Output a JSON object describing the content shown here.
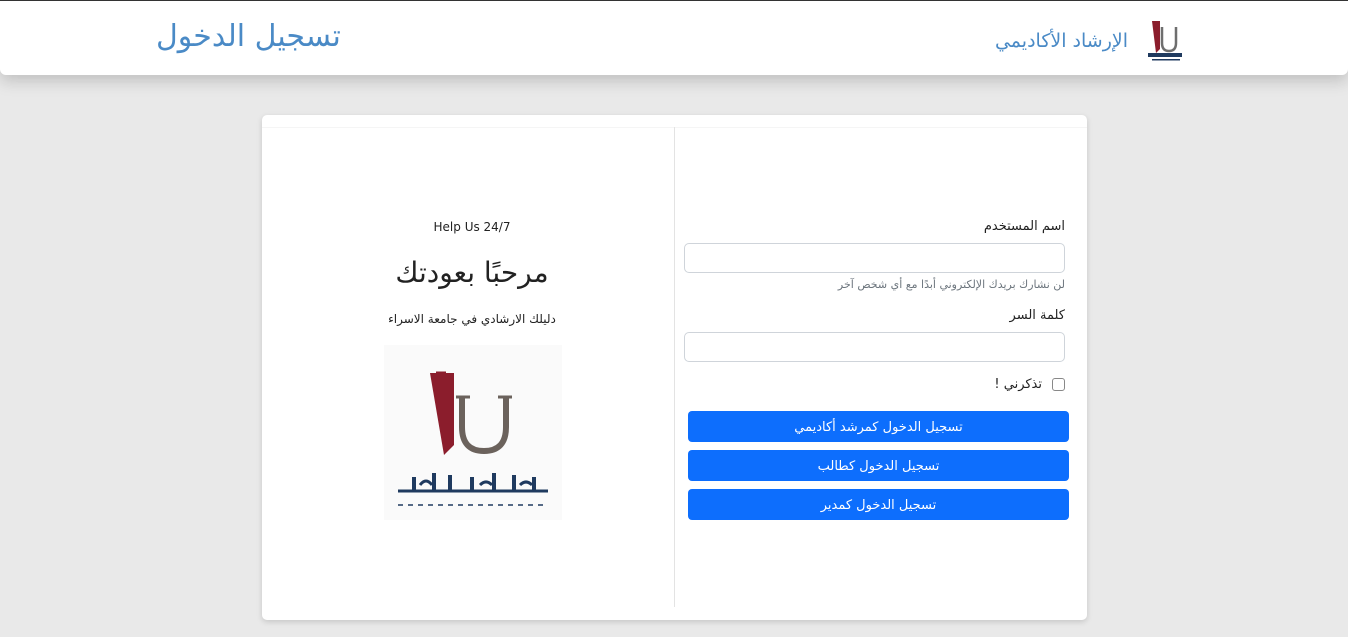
{
  "header": {
    "brand_title": "الإرشاد الأكاديمي",
    "brand_logo_icon": "isra-university-logo-icon",
    "page_title": "تسجيل الدخول"
  },
  "intro": {
    "help_text": "Help Us 24/7",
    "welcome": "مرحبًا بعودتك",
    "guide": "دليلك الارشادي في جامعة الاسراء",
    "logo_icon": "isra-university-logo-icon",
    "logo_arabic": "جامعة الإسراء",
    "logo_english": "ISRA UNIVERSITY"
  },
  "form": {
    "username_label": "اسم المستخدم",
    "username_value": "",
    "username_placeholder": "",
    "username_help": "لن نشارك بريدك الإلكتروني أبدًا مع أي شخص آخر",
    "password_label": "كلمة السر",
    "password_value": "",
    "password_placeholder": "",
    "remember_label": "تذكرني !",
    "remember_checked": false,
    "buttons": [
      {
        "label": "تسجيل الدخول كمرشد أكاديمي"
      },
      {
        "label": "تسجيل الدخول كطالب"
      },
      {
        "label": "تسجيل الدخول كمدير"
      }
    ]
  },
  "colors": {
    "accent": "#4a8ac6",
    "primary_button": "#0d6efd",
    "logo_red": "#8b1d2c",
    "logo_gray": "#6e6e6e",
    "logo_navy": "#1f3a5f"
  }
}
